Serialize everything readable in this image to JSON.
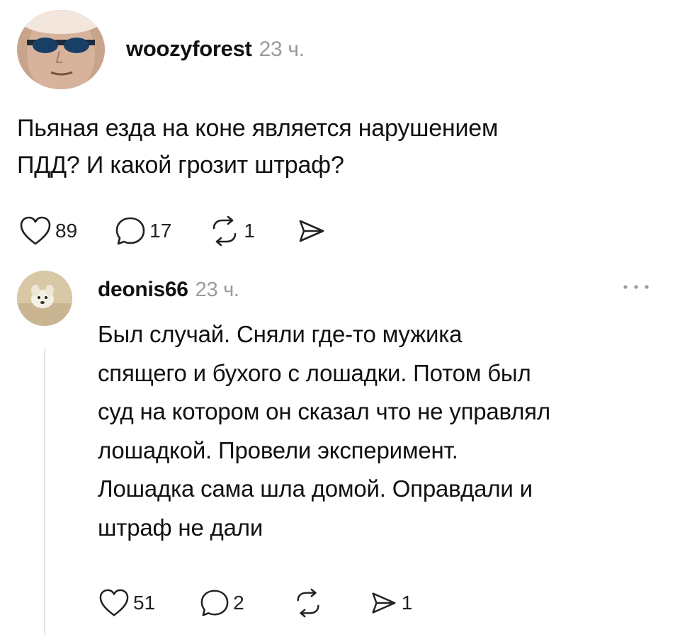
{
  "post": {
    "username": "woozyforest",
    "time": "23 ч.",
    "text_line1": "Пьяная езда на коне является нарушением",
    "text_line2": "ПДД? И какой грозит штраф?",
    "likes": "89",
    "comments": "17",
    "reposts": "1"
  },
  "reply": {
    "username": "deonis66",
    "time": "23 ч.",
    "lines": [
      "Был случай. Сняли где-то мужика",
      "спящего и бухого с лошадки. Потом был",
      "суд на котором он сказал что не управлял",
      "лошадкой. Провели эксперимент.",
      "Лошадка сама шла домой. Оправдали и",
      "штраф не дали"
    ],
    "likes": "51",
    "comments": "2",
    "shares": "1"
  },
  "icons": {
    "like": "heart-icon",
    "comment": "speech-bubble-icon",
    "repost": "repost-icon",
    "share": "send-icon",
    "more": "more-icon"
  }
}
